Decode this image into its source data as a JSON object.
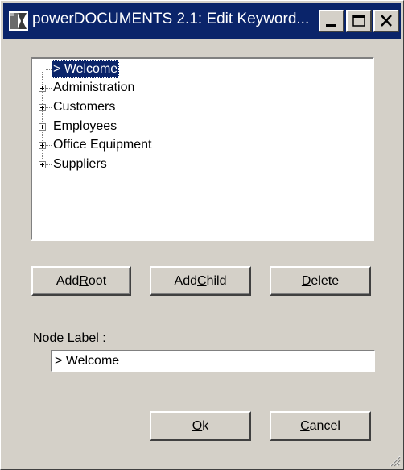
{
  "window": {
    "title": "powerDOCUMENTS 2.1: Edit Keyword...",
    "minimize_icon": "minimize-icon",
    "maximize_icon": "maximize-icon",
    "close_icon": "close-icon"
  },
  "tree": {
    "selected": "> Welcome",
    "items": [
      {
        "label": "Administration"
      },
      {
        "label": "Customers"
      },
      {
        "label": "Employees"
      },
      {
        "label": "Office Equipment"
      },
      {
        "label": "Suppliers"
      }
    ]
  },
  "buttons": {
    "add_root": {
      "pre": "Add",
      "mnemonic": "R",
      "post": "oot"
    },
    "add_child": {
      "pre": "Add",
      "mnemonic": "C",
      "post": "hild"
    },
    "delete": {
      "pre": "",
      "mnemonic": "D",
      "post": "elete"
    },
    "ok": {
      "pre": "",
      "mnemonic": "O",
      "post": "k"
    },
    "cancel": {
      "pre": "",
      "mnemonic": "C",
      "post": "ancel"
    }
  },
  "node_label": {
    "label": "Node Label :",
    "value": "> Welcome"
  },
  "colors": {
    "titlebar": "#0a246a",
    "face": "#d4d0c8",
    "selection": "#0a246a"
  }
}
